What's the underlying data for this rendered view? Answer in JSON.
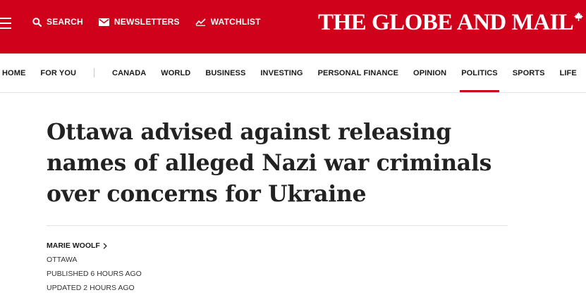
{
  "top_nav": {
    "search_label": "SEARCH",
    "newsletters_label": "NEWSLETTERS",
    "watchlist_label": "WATCHLIST",
    "icons": [
      "menu-icon",
      "search-icon",
      "envelope-icon",
      "trend-chart-icon"
    ]
  },
  "brand": {
    "logo_text": "THE GLOBE AND MAIL",
    "logo_mark": "maple-leaf-icon",
    "accent_color": "#d0021b"
  },
  "section_nav": {
    "items": [
      "HOME",
      "FOR YOU",
      "CANADA",
      "WORLD",
      "BUSINESS",
      "INVESTING",
      "PERSONAL FINANCE",
      "OPINION",
      "POLITICS",
      "SPORTS",
      "LIFE"
    ],
    "active": "POLITICS"
  },
  "article": {
    "headline": "Ottawa advised against releasing names of alleged Nazi war criminals over concerns for Ukraine",
    "author": "MARIE WOOLF",
    "location": "OTTAWA",
    "published": "PUBLISHED 6 HOURS AGO",
    "updated": "UPDATED 2 HOURS AGO"
  }
}
